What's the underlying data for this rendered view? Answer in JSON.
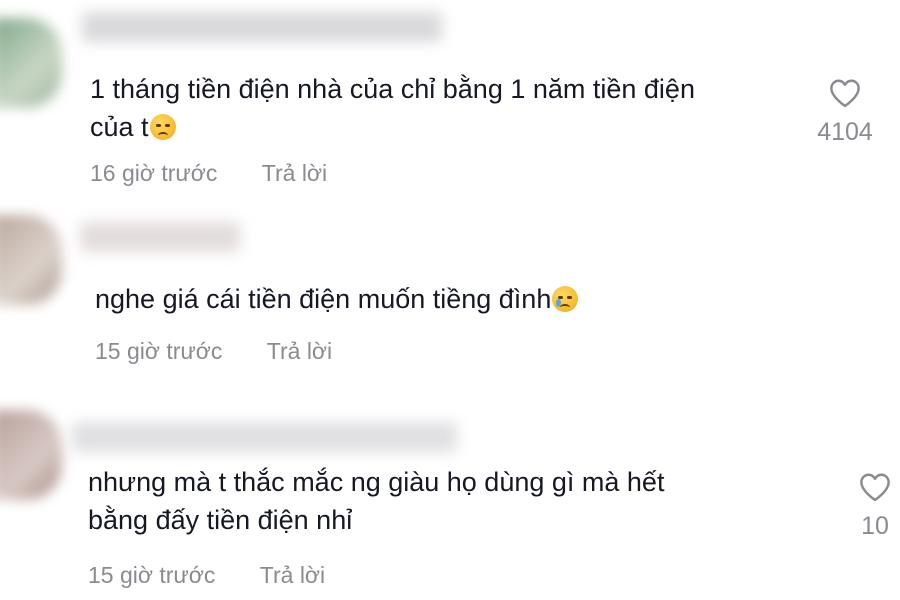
{
  "colors": {
    "text_primary": "#161823",
    "text_secondary": "#8a8b91",
    "icon": "#8a8b91"
  },
  "comments": [
    {
      "text_lines": [
        "1 tháng tiền điện nhà của chỉ bằng 1 năm tiền điện",
        "của t"
      ],
      "emoji": "disappointed-face",
      "time": "16 giờ trước",
      "reply": "Trả lời",
      "likes": "4104"
    },
    {
      "text_lines": [
        "nghe giá cái tiền điện muốn tiềng đình"
      ],
      "emoji": "crying-face",
      "time": "15 giờ trước",
      "reply": "Trả lời",
      "likes": ""
    },
    {
      "text_lines": [
        "nhưng mà t thắc mắc ng giàu họ dùng gì mà hết",
        "bằng đấy tiền điện nhỉ"
      ],
      "emoji": "",
      "time": "15 giờ trước",
      "reply": "Trả lời",
      "likes": "10"
    }
  ]
}
